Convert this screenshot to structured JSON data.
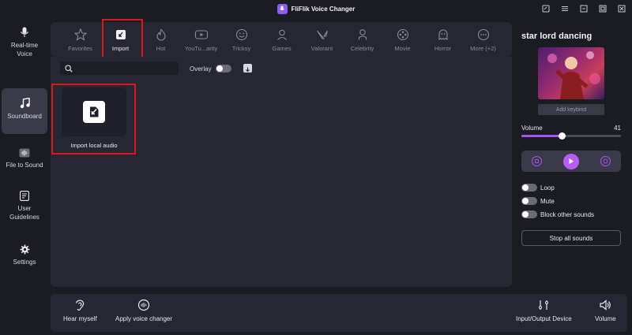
{
  "app": {
    "title": "FliFlik Voice Changer"
  },
  "sidebar": {
    "items": [
      {
        "label": "Real-time\nVoice",
        "icon": "microphone-icon"
      },
      {
        "label": "Soundboard",
        "icon": "music-note-icon"
      },
      {
        "label": "File to Sound",
        "icon": "audio-file-icon"
      },
      {
        "label": "User\nGuidelines",
        "icon": "guidelines-icon"
      },
      {
        "label": "Settings",
        "icon": "gear-icon"
      }
    ],
    "active": "Soundboard"
  },
  "categories": {
    "items": [
      {
        "label": "Favorites",
        "icon": "star-icon"
      },
      {
        "label": "Import",
        "icon": "import-icon"
      },
      {
        "label": "Hot",
        "icon": "flame-icon"
      },
      {
        "label": "YouTu...arity",
        "icon": "youtube-icon"
      },
      {
        "label": "Tricksy",
        "icon": "smiley-icon"
      },
      {
        "label": "Games",
        "icon": "person-icon"
      },
      {
        "label": "Valorant",
        "icon": "valorant-icon"
      },
      {
        "label": "Celebrity",
        "icon": "celebrity-icon"
      },
      {
        "label": "Movie",
        "icon": "film-reel-icon"
      },
      {
        "label": "Horror",
        "icon": "ghost-icon"
      },
      {
        "label": "More (+2)",
        "icon": "more-icon"
      }
    ],
    "active": "Import"
  },
  "main": {
    "search": {
      "value": "",
      "placeholder": ""
    },
    "overlay": {
      "label": "Overlay",
      "enabled": false
    },
    "import_card": {
      "label": "Import local audio"
    }
  },
  "right_panel": {
    "sound_title": "star lord dancing",
    "add_keybind": "Add keybind",
    "volume": {
      "label": "Volume",
      "value": "41",
      "level": 0.41
    },
    "options": [
      {
        "label": "Loop",
        "enabled": false
      },
      {
        "label": "Mute",
        "enabled": false
      },
      {
        "label": "Block other sounds",
        "enabled": false
      }
    ],
    "stop_all": "Stop all sounds"
  },
  "bottom_bar": {
    "hear_myself": "Hear myself",
    "apply_voice_changer": "Apply voice changer",
    "io_device": "Input/Output Device",
    "volume": "Volume"
  },
  "colors": {
    "accent": "#a855f7",
    "highlight_box": "#e0141b",
    "panel": "#272733",
    "background": "#1b1b22"
  }
}
